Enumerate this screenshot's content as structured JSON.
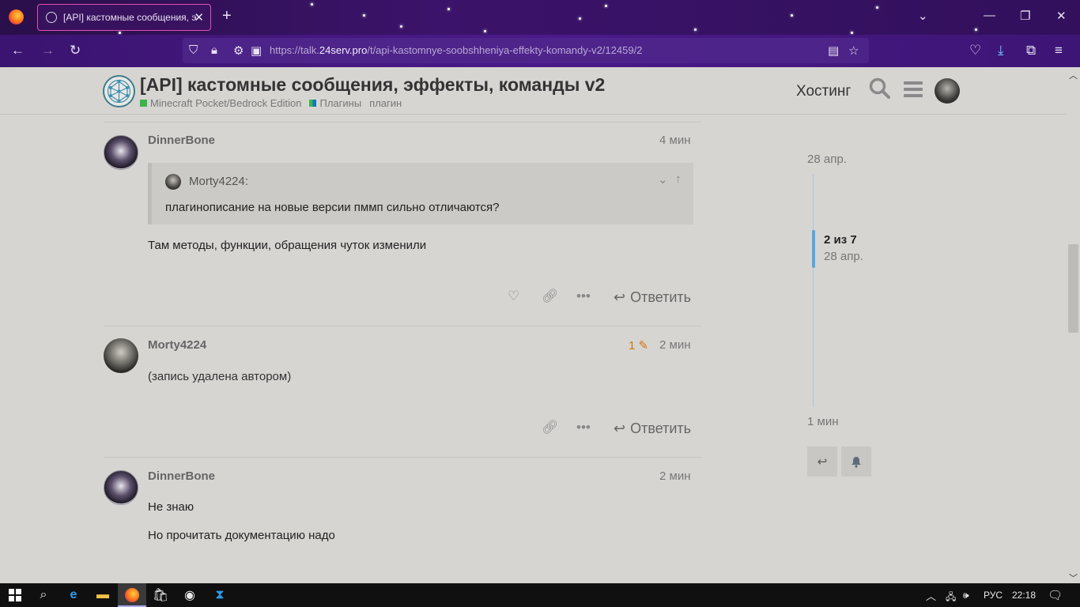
{
  "browser": {
    "tab_title": "[API] кастомные сообщения, э",
    "tab_close": "✕",
    "new_tab": "+",
    "url_prefix": "https://talk.",
    "url_domain": "24serv.pro",
    "url_path": "/t/api-kastomnye-soobshheniya-effekty-komandy-v2/12459/2"
  },
  "header": {
    "title": "[API] кастомные сообщения, эффекты, команды v2",
    "categories": [
      {
        "label": "Minecraft Pocket/Bedrock Edition",
        "color": "#3ab54a"
      },
      {
        "label": "Плагины",
        "color": "#3ab54a",
        "color2": "#0e76bd"
      }
    ],
    "tag": "плагин",
    "hosting_link": "Хостинг"
  },
  "posts": [
    {
      "username": "DinnerBone",
      "time": "4 мин",
      "quote": {
        "username": "Morty4224:",
        "text": "плагинописание на новые версии пммп сильно отличаются?"
      },
      "text": "Там методы, функции, обращения чуток изменили",
      "reply_label": "Ответить"
    },
    {
      "username": "Morty4224",
      "edit_count": "1",
      "time": "2 мин",
      "text": "(запись удалена автором)",
      "reply_label": "Ответить"
    },
    {
      "username": "DinnerBone",
      "time": "2 мин",
      "text_lines": [
        "Не знаю",
        "Но прочитать документацию надо"
      ]
    }
  ],
  "timeline": {
    "start_date": "28 апр.",
    "position": "2 из 7",
    "current_date": "28 апр.",
    "end_date": "1 мин"
  },
  "taskbar": {
    "lang": "РУС",
    "time": "22:18"
  }
}
